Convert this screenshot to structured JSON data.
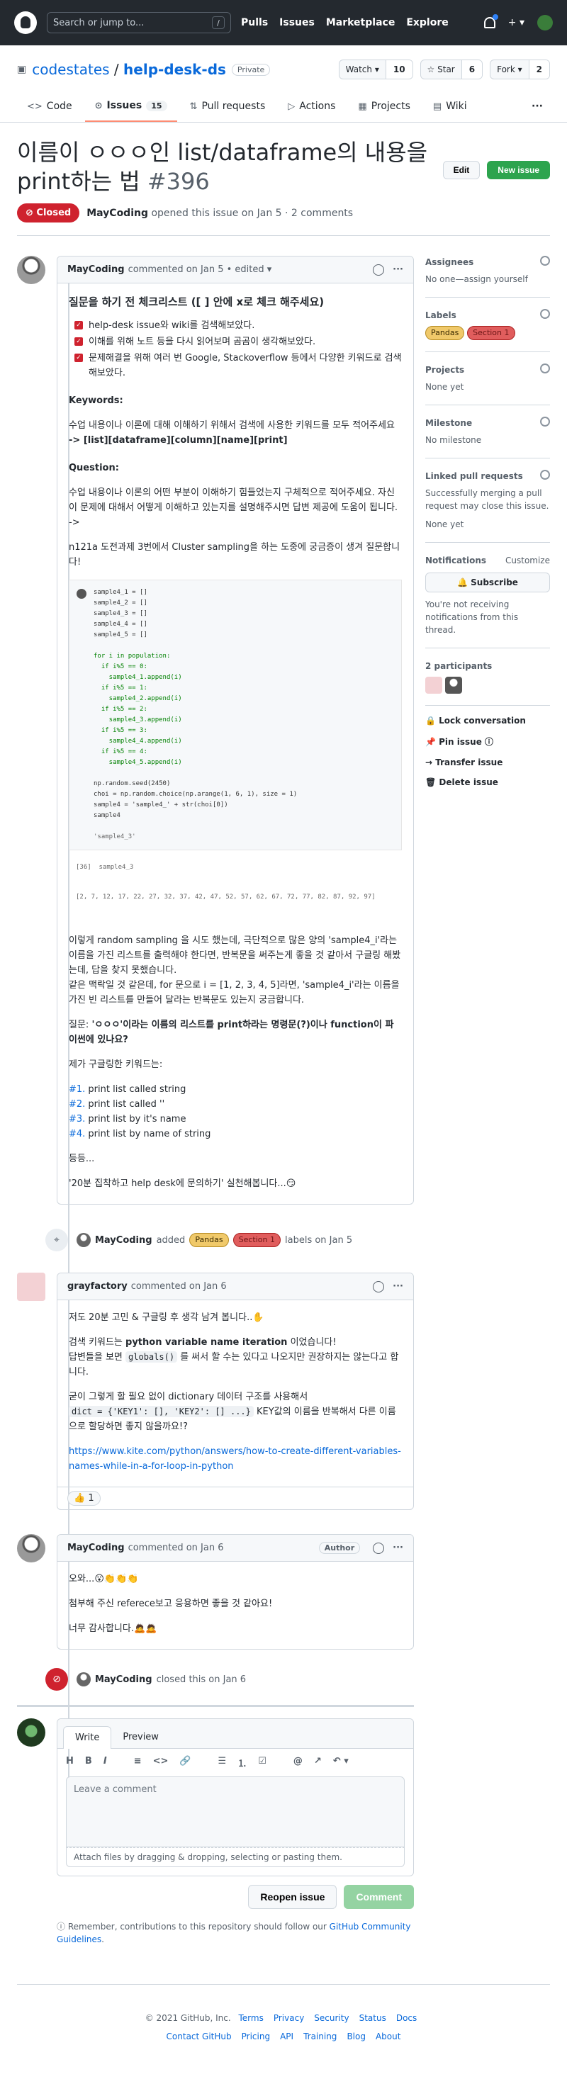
{
  "topbar": {
    "search_placeholder": "Search or jump to...",
    "slash": "/",
    "nav": [
      "Pulls",
      "Issues",
      "Marketplace",
      "Explore"
    ],
    "plus": "+ ▾"
  },
  "repo": {
    "owner": "codestates",
    "name": "help-desk-ds",
    "sep": "/",
    "visibility": "Private",
    "watch_label": "Watch ▾",
    "watch_count": "10",
    "star_label": "☆ Star",
    "star_count": "6",
    "fork_label": "Fork ▾",
    "fork_count": "2"
  },
  "tabs": [
    {
      "label": "Code",
      "icon": "<>"
    },
    {
      "label": "Issues",
      "icon": "⊙",
      "count": "15"
    },
    {
      "label": "Pull requests",
      "icon": "⇅"
    },
    {
      "label": "Actions",
      "icon": "▷"
    },
    {
      "label": "Projects",
      "icon": "▦"
    },
    {
      "label": "Wiki",
      "icon": "▤"
    }
  ],
  "tab_more": "···",
  "issue": {
    "title": "이름이 ㅇㅇㅇ인 list/dataframe의 내용을 print하는 법",
    "number": "#396",
    "edit_label": "Edit",
    "new_label": "New issue",
    "state": "Closed",
    "author": "MayCoding",
    "meta": "opened this issue on Jan 5 · 2 comments"
  },
  "comment1": {
    "author": "MayCoding",
    "meta": "commented on Jan 5 • edited ▾",
    "heading": "질문을 하기 전 체크리스트 ([ ] 안에 x로 체크 해주세요)",
    "checks": [
      "help-desk issue와 wiki를 검색해보았다.",
      "이해를 위해 노트 등을 다시 읽어보며 곰곰이 생각해보았다.",
      "문제해결을 위해 여러 번 Google, Stackoverflow 등에서 다양한 키워드로 검색해보았다."
    ],
    "keywords_label": "Keywords:",
    "keywords_desc": "수업 내용이나 이론에 대해 이해하기 위해서 검색에 사용한 키워드를 모두 적어주세요",
    "keywords": "-> [list][dataframe][column][name][print]",
    "question_label": "Question:",
    "question_desc": "수업 내용이나 이론의 어떤 부분이 이해하기 힘들었는지 구체적으로 적어주세요. 자신이 문제에 대해서 어떻게 이해하고 있는지를 설명해주시면 답변 제공에 도움이 됩니다.",
    "arrow": "->",
    "intro": "n121a 도전과제 3번에서 Cluster sampling을 하는 도중에 궁금증이 생겨 질문합니다!",
    "code1": "sample4_1 = []\nsample4_2 = []\nsample4_3 = []\nsample4_4 = []\nsample4_5 = []",
    "code2a": "for i in population:\n  if i%5 == 0:\n    sample4_1.append(i)\n  if i%5 == 1:\n    sample4_2.append(i)\n  if i%5 == 2:\n    sample4_3.append(i)\n  if i%5 == 3:\n    sample4_4.append(i)\n  if i%5 == 4:\n    sample4_5.append(i)",
    "code3": "np.random.seed(2450)\nchoi = np.random.choice(np.arange(1, 6, 1), size = 1)\nsample4 = 'sample4_' + str(choi[0])\nsample4",
    "out1": "'sample4_3'",
    "in2": "[36]  sample4_3",
    "out2": "[2, 7, 12, 17, 22, 27, 32, 37, 42, 47, 52, 57, 62, 67, 72, 77, 82, 87, 92, 97]",
    "p1": "이렇게 random sampling 을 시도 했는데, 극단적으로 많은 양의 'sample4_i'라는 이름을 가진 리스트를 출력해야 한다면, 반복문을 써주는게 좋을 것 같아서 구글링 해봤는데, 답을 찾지 못했습니다.",
    "p2": "같은 맥락일 것 같은데, for 문으로 i = [1, 2, 3, 4, 5]라면, 'sample4_i'라는 이름을 가진 빈 리스트를 만들어 달라는 반복문도 있는지 궁금합니다.",
    "q_prefix": "질문: ",
    "q_bold": "'ㅇㅇㅇ'이라는 이름의 리스트를 print하라는 명령문(?)이나 function이 파이썬에 있나요?",
    "searched": "제가 구글링한 키워드는:",
    "kw_list": [
      {
        "num": "#1.",
        "text": " print list called string"
      },
      {
        "num": "#2.",
        "text": " print list called ''"
      },
      {
        "num": "#3.",
        "text": " print list by it's name"
      },
      {
        "num": "#4.",
        "text": " print list by name of string"
      }
    ],
    "etc": "등등...",
    "closing": "'20분 집착하고 help desk에 문의하기' 실천해봅니다...😏"
  },
  "event1": {
    "author": "MayCoding",
    "added": "added",
    "label1": "Pandas",
    "label2": "Section 1",
    "rest": "labels on Jan 5"
  },
  "comment2": {
    "author": "grayfactory",
    "meta": "commented on Jan 6",
    "p1": "저도 20분 고민 & 구글링 후 생각 남겨 봅니다..✋",
    "p2a": "검색 키워드는 ",
    "p2b": "python variable name iteration",
    "p2c": " 이었습니다!",
    "p3a": "답변들을 보면 ",
    "p3code": "globals()",
    "p3b": " 를 써서 할 수는 있다고 나오지만 권장하지는 않는다고 합니다.",
    "p4a": "굳이 그렇게 할 필요 없이 dictionary 데이터 구조를 사용해서",
    "p4code": "dict = {'KEY1': [], 'KEY2': [] ...}",
    "p4b": " KEY값의 이름을 반복해서 다른 이름으로 할당하면 좋지 않을까요!?",
    "link": "https://www.kite.com/python/answers/how-to-create-different-variables-names-while-in-a-for-loop-in-python",
    "reaction": "👍 1"
  },
  "comment3": {
    "author": "MayCoding",
    "meta": "commented on Jan 6",
    "author_tag": "Author",
    "p1": "오와...😮👏👏👏",
    "p2": "첨부해 주신 referece보고 응용하면 좋을 것 같아요!",
    "p3": "너무 감사합니다.🙇🙇"
  },
  "event2": {
    "author": "MayCoding",
    "text": "closed this on Jan 6"
  },
  "editor": {
    "tab_write": "Write",
    "tab_preview": "Preview",
    "placeholder": "Leave a comment",
    "attach": "Attach files by dragging & dropping, selecting or pasting them.",
    "reopen": "Reopen issue",
    "comment_btn": "Comment",
    "tools": [
      "H",
      "B",
      "I",
      "≡",
      "<>",
      "🔗",
      "☰",
      "⒈",
      "☑",
      "@",
      "↗",
      "↶ ▾"
    ]
  },
  "remember": {
    "text": "Remember, contributions to this repository should follow our ",
    "link": "GitHub Community Guidelines",
    "end": "."
  },
  "sidebar": {
    "assignees_h": "Assignees",
    "assignees": "No one—assign yourself",
    "labels_h": "Labels",
    "label1": "Pandas",
    "label2": "Section 1",
    "projects_h": "Projects",
    "projects": "None yet",
    "milestone_h": "Milestone",
    "milestone": "No milestone",
    "linked_h": "Linked pull requests",
    "linked": "Successfully merging a pull request may close this issue.",
    "linked_none": "None yet",
    "notif_h": "Notifications",
    "customize": "Customize",
    "subscribe": "🔔 Subscribe",
    "notif_desc": "You're not receiving notifications from this thread.",
    "participants_h": "2 participants",
    "lock": "🔒 Lock conversation",
    "pin": "📌 Pin issue ⓘ",
    "transfer": "→ Transfer issue",
    "delete": "🗑 Delete issue"
  },
  "footer": {
    "copyright": "© 2021 GitHub, Inc.",
    "row1": [
      "Terms",
      "Privacy",
      "Security",
      "Status",
      "Docs"
    ],
    "row2": [
      "Contact GitHub",
      "Pricing",
      "API",
      "Training",
      "Blog",
      "About"
    ]
  },
  "colors": {
    "closed": "#cf222e",
    "green": "#2da44e",
    "link": "#0969da"
  }
}
